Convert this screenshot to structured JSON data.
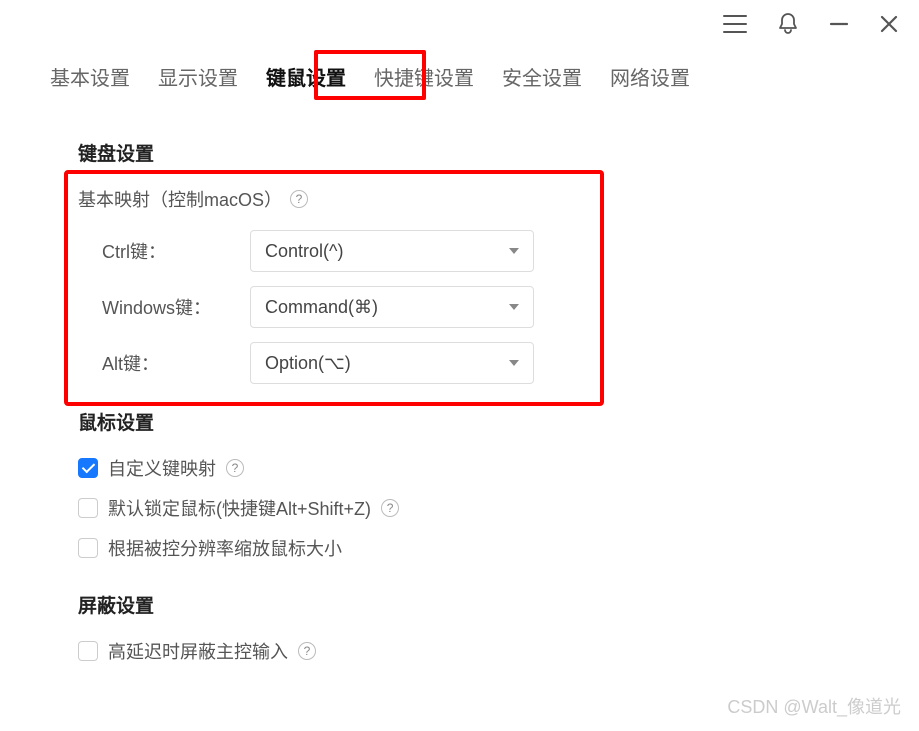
{
  "tabs": {
    "basic": "基本设置",
    "display": "显示设置",
    "km": "键鼠设置",
    "shortcut": "快捷键设置",
    "security": "安全设置",
    "network": "网络设置"
  },
  "keyboard": {
    "heading": "键盘设置",
    "mapping_title": "基本映射（控制macOS）",
    "rows": {
      "ctrl": {
        "label": "Ctrl键：",
        "value": "Control(^)"
      },
      "win": {
        "label": "Windows键：",
        "value": "Command(⌘)"
      },
      "alt": {
        "label": "Alt键：",
        "value": "Option(⌥)"
      }
    }
  },
  "mouse": {
    "heading": "鼠标设置",
    "custom_map": {
      "label": "自定义键映射",
      "checked": true
    },
    "lock_mouse": {
      "label": "默认锁定鼠标(快捷键Alt+Shift+Z)",
      "checked": false
    },
    "scale_cursor": {
      "label": "根据被控分辨率缩放鼠标大小",
      "checked": false
    }
  },
  "shield": {
    "heading": "屏蔽设置",
    "high_latency": {
      "label": "高延迟时屏蔽主控输入",
      "checked": false
    }
  },
  "watermark": "CSDN @Walt_像道光"
}
